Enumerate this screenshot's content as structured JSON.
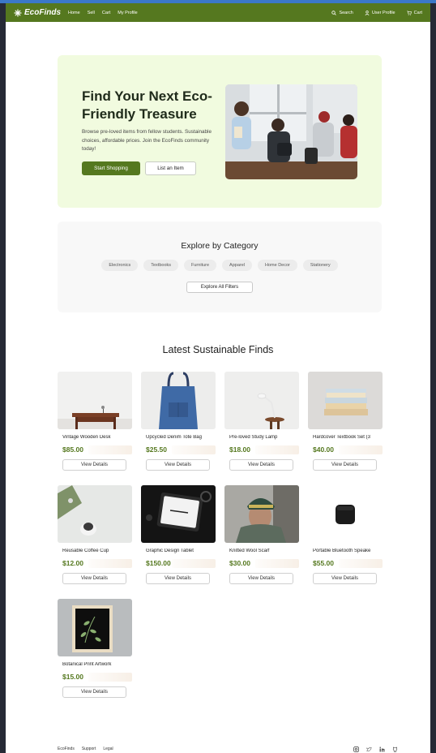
{
  "nav": {
    "brand": "EcoFinds",
    "links": [
      "Home",
      "Sell",
      "Cart",
      "My Profile"
    ],
    "search_label": "Search",
    "profile_label": "User Profile",
    "cart_label": "Cart"
  },
  "hero": {
    "title": "Find Your Next Eco-Friendly Treasure",
    "description": "Browse pre-loved items from fellow students. Sustainable choices, affordable prices. Join the EcoFinds community today!",
    "primary_button": "Start Shopping",
    "secondary_button": "List an Item"
  },
  "categories": {
    "title": "Explore by Category",
    "chips": [
      "Electronics",
      "Textbooks",
      "Furniture",
      "Apparel",
      "Home Decor",
      "Stationery"
    ],
    "filters_button": "Explore All Filters"
  },
  "products": {
    "title": "Latest Sustainable Finds",
    "view_label": "View Details",
    "items": [
      {
        "name": "Vintage Wooden Desk",
        "price": "$85.00",
        "icon": "desk"
      },
      {
        "name": "Upcycled Denim Tote Bag",
        "price": "$25.50",
        "icon": "tote-bag"
      },
      {
        "name": "Pre-loved Study Lamp",
        "price": "$18.00",
        "icon": "lamp"
      },
      {
        "name": "Hardcover Textbook Set (3",
        "price": "$40.00",
        "icon": "books"
      },
      {
        "name": "Reusable Coffee Cup",
        "price": "$12.00",
        "icon": "coffee-cup"
      },
      {
        "name": "Graphic Design Tablet",
        "price": "$150.00",
        "icon": "tablet"
      },
      {
        "name": "Knitted Wool Scarf",
        "price": "$30.00",
        "icon": "scarf"
      },
      {
        "name": "Portable Bluetooth Speake",
        "price": "$55.00",
        "icon": "speaker"
      },
      {
        "name": "Botanical Print Artwork",
        "price": "$15.00",
        "icon": "artwork"
      }
    ]
  },
  "footer": {
    "links": [
      "EcoFinds",
      "Support",
      "Legal"
    ],
    "social_icons": [
      "instagram-icon",
      "twitter-icon",
      "linkedin-icon",
      "github-icon"
    ]
  },
  "colors": {
    "brand_green": "#55781f",
    "hero_bg": "#f1fbdf"
  }
}
